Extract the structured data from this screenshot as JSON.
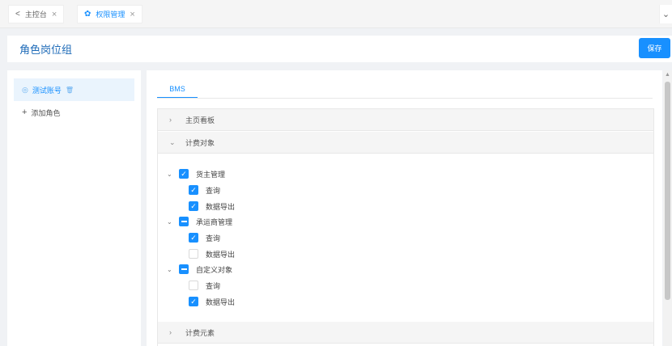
{
  "tabs": [
    {
      "icon": "<",
      "label": "主控台",
      "close": "×"
    },
    {
      "icon": "✿",
      "label": "权限管理",
      "close": "×"
    }
  ],
  "tab_more": "⌄",
  "page": {
    "title": "角色岗位组",
    "save_label": "保存"
  },
  "roles": {
    "selected": "测试账号",
    "add_label": "添加角色"
  },
  "module_tab": "BMS",
  "sections": [
    {
      "label": "主页看板",
      "expanded": false
    },
    {
      "label": "计费对象",
      "expanded": true
    },
    {
      "label": "计费元素",
      "expanded": false
    }
  ],
  "tree": [
    {
      "label": "货主管理",
      "state": "checked",
      "children": [
        {
          "label": "查询",
          "state": "checked"
        },
        {
          "label": "数据导出",
          "state": "checked"
        }
      ]
    },
    {
      "label": "承运商管理",
      "state": "indeterminate",
      "children": [
        {
          "label": "查询",
          "state": "checked"
        },
        {
          "label": "数据导出",
          "state": "unchecked"
        }
      ]
    },
    {
      "label": "自定义对象",
      "state": "indeterminate",
      "children": [
        {
          "label": "查询",
          "state": "unchecked"
        },
        {
          "label": "数据导出",
          "state": "checked"
        }
      ]
    }
  ],
  "colors": {
    "accent": "#1890ff",
    "title": "#1e6bb8",
    "selected_bg": "#eaf4fd"
  }
}
